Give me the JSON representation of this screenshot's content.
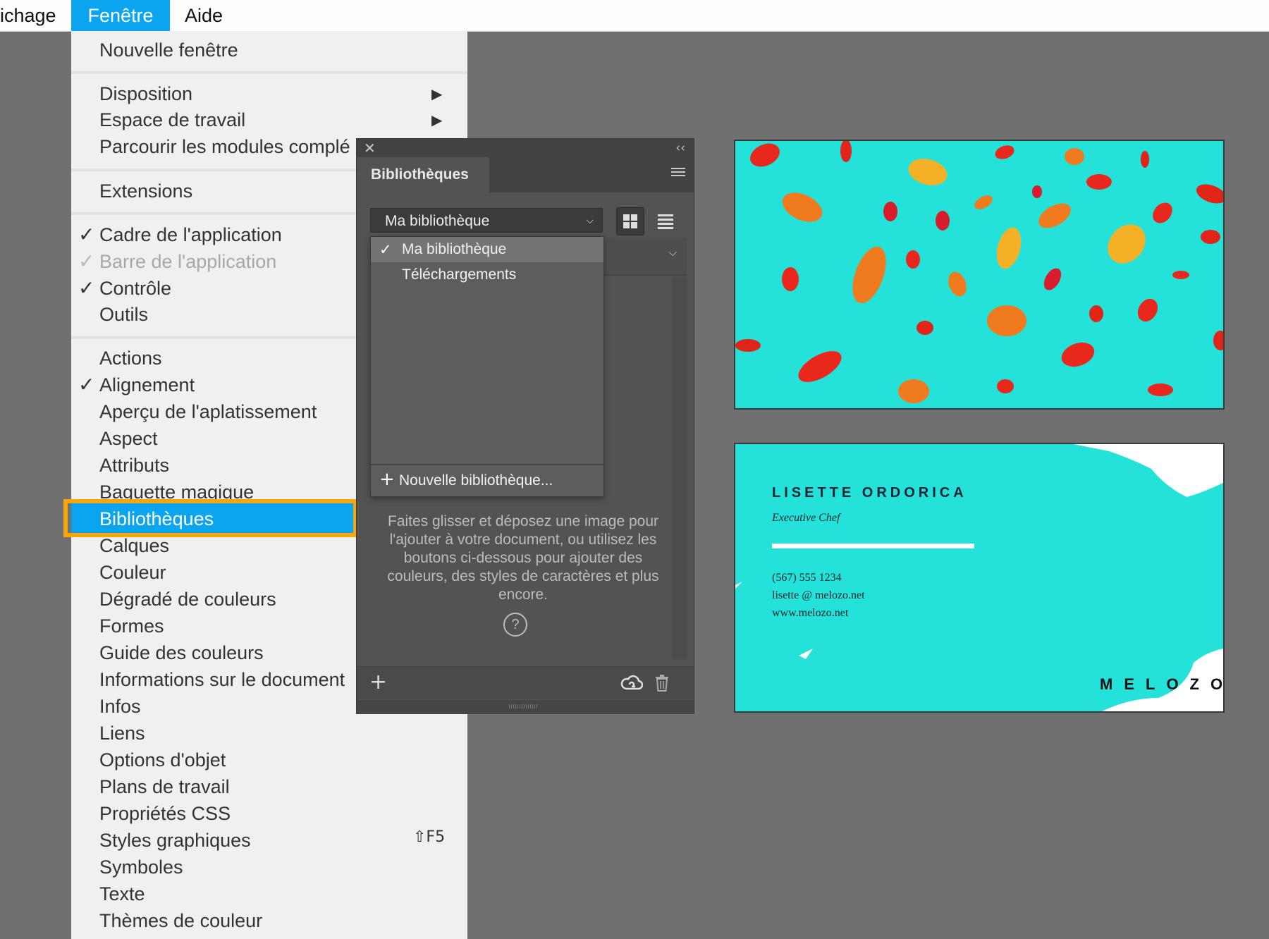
{
  "menubar": {
    "items": [
      "ichage",
      "Fenêtre",
      "Aide"
    ],
    "active": "Fenêtre"
  },
  "window_menu": {
    "items": [
      "Nouvelle fenêtre",
      "Disposition",
      "Espace de travail",
      "Parcourir les modules complé",
      "Extensions",
      "Cadre de l'application",
      "Barre de l'application",
      "Contrôle",
      "Outils",
      "Actions",
      "Alignement",
      "Aperçu de l'aplatissement",
      "Aspect",
      "Attributs",
      "Baguette magique",
      "Bibliothèques",
      "Calques",
      "Couleur",
      "Dégradé de couleurs",
      "Formes",
      "Guide des couleurs",
      "Informations sur le document",
      "Infos",
      "Liens",
      "Options d'objet",
      "Plans de travail",
      "Propriétés CSS",
      "Styles graphiques",
      "Symboles",
      "Texte",
      "Thèmes de couleur"
    ],
    "checked": [
      "Cadre de l'application",
      "Barre de l'application",
      "Contrôle",
      "Alignement"
    ],
    "disabled": [
      "Barre de l'application"
    ],
    "submenus": [
      "Disposition",
      "Espace de travail"
    ],
    "highlighted": "Bibliothèques",
    "shortcut_styles": "⇧F5"
  },
  "libraries_panel": {
    "tab": "Bibliothèques",
    "selected_library": "Ma bibliothèque",
    "dropdown_options": [
      "Ma bibliothèque",
      "Téléchargements"
    ],
    "new_library": "Nouvelle bibliothèque...",
    "description": "Faites glisser et déposez une image pour l'ajouter à votre document, ou utilisez les boutons ci-dessous pour ajouter des couleurs, des styles de caractères et plus encore.",
    "help": "?",
    "icons": {
      "close": "close-icon",
      "collapse": "double-chevron-left-icon",
      "menu": "hamburger-menu-icon",
      "grid_view": "grid-view-icon",
      "list_view": "list-view-icon",
      "add": "plus-icon",
      "cloud": "creative-cloud-icon",
      "trash": "trash-icon"
    }
  },
  "business_card": {
    "name": "LISETTE ORDORICA",
    "role": "Executive Chef",
    "phone": "(567) 555 1234",
    "email": "lisette @ melozo.net",
    "web": "www.melozo.net",
    "brand": "MELOZO"
  },
  "colors": {
    "accent": "#0aa4ef",
    "highlight_border": "#f5a70c",
    "turquoise": "#24e2da",
    "pepper_red": "#e8281c",
    "pepper_orange": "#f07a1e",
    "pepper_yellow": "#f4b128"
  }
}
